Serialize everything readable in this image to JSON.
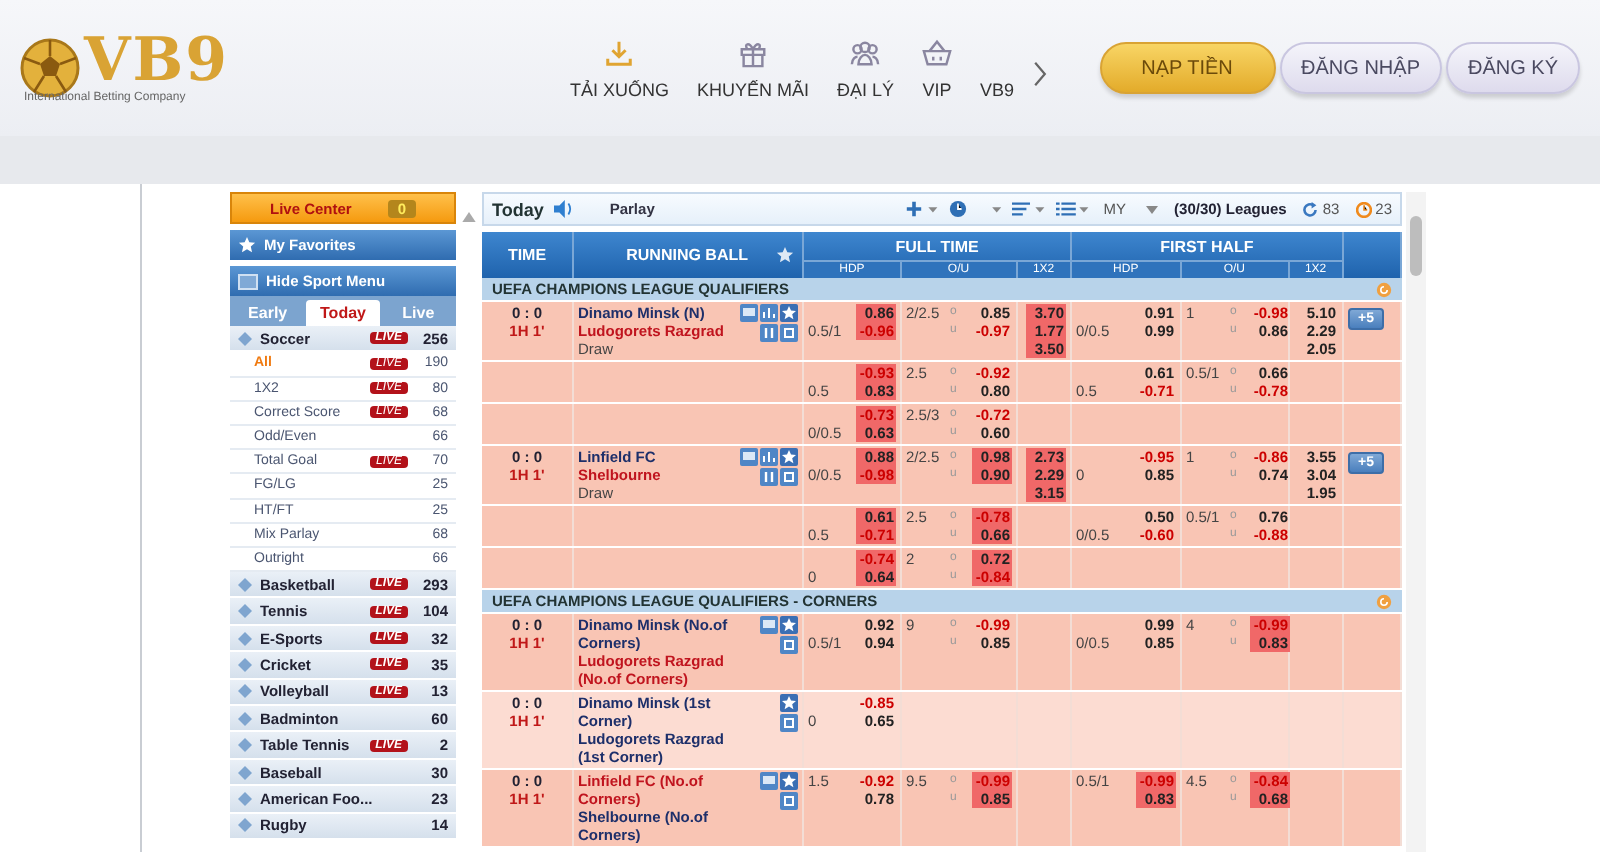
{
  "header": {
    "logo": {
      "name": "VB9",
      "tagline": "International Betting Company"
    },
    "nav": [
      {
        "label": "TẢI XUỐNG",
        "kind": "download"
      },
      {
        "label": "KHUYẾN MÃI",
        "kind": "gift"
      },
      {
        "label": "ĐẠI LÝ",
        "kind": "agents"
      },
      {
        "label": "VIP",
        "kind": "basket"
      },
      {
        "label": "VB9",
        "kind": "none"
      }
    ],
    "buttons": [
      {
        "label": "NẠP TIỀN",
        "kind": "primary"
      },
      {
        "label": "ĐĂNG NHẬP",
        "kind": "secondary"
      },
      {
        "label": "ĐĂNG KÝ",
        "kind": "secondary"
      }
    ]
  },
  "sidebar": {
    "live_center": {
      "label": "Live Center",
      "count": "0"
    },
    "favorites": "My Favorites",
    "menu_toggle": "Hide Sport Menu",
    "tabs": [
      {
        "label": "Early",
        "selected": false
      },
      {
        "label": "Today",
        "selected": true
      },
      {
        "label": "Live",
        "selected": false
      }
    ],
    "sports": [
      {
        "name": "Soccer",
        "badge": "LIVE",
        "count": "256",
        "expanded": true,
        "children": [
          {
            "name": "All",
            "badge": "LIVE",
            "count": "190",
            "selected": true
          },
          {
            "name": "1X2",
            "badge": "LIVE",
            "count": "80",
            "selected": false
          },
          {
            "name": "Correct Score",
            "badge": "LIVE",
            "count": "68",
            "selected": false
          },
          {
            "name": "Odd/Even",
            "count": "66",
            "selected": false
          },
          {
            "name": "Total Goal",
            "badge": "LIVE",
            "count": "70",
            "selected": false
          },
          {
            "name": "FG/LG",
            "count": "25",
            "selected": false
          },
          {
            "name": "HT/FT",
            "count": "25",
            "selected": false
          },
          {
            "name": "Mix Parlay",
            "count": "68",
            "selected": false
          },
          {
            "name": "Outright",
            "count": "66",
            "selected": false
          }
        ]
      },
      {
        "name": "Basketball",
        "badge": "LIVE",
        "count": "293",
        "expanded": false
      },
      {
        "name": "Tennis",
        "badge": "LIVE",
        "count": "104",
        "expanded": false
      },
      {
        "name": "E-Sports",
        "badge": "LIVE",
        "count": "32",
        "expanded": false
      },
      {
        "name": "Cricket",
        "badge": "LIVE",
        "count": "35",
        "expanded": false
      },
      {
        "name": "Volleyball",
        "badge": "LIVE",
        "count": "13",
        "expanded": false
      },
      {
        "name": "Badminton",
        "count": "60",
        "expanded": false
      },
      {
        "name": "Table Tennis",
        "badge": "LIVE",
        "count": "2",
        "expanded": false
      },
      {
        "name": "Baseball",
        "count": "30",
        "expanded": false
      },
      {
        "name": "American Foo...",
        "count": "23",
        "expanded": false
      },
      {
        "name": "Rugby",
        "count": "14",
        "expanded": false
      }
    ]
  },
  "toolbar": {
    "title": "Today",
    "mode": "Parlay",
    "odds_type": "MY",
    "leagues": "(30/30) Leagues",
    "counters": [
      {
        "kind": "refresh",
        "value": "83"
      },
      {
        "kind": "timer",
        "value": "23"
      }
    ]
  },
  "columns": {
    "time": "TIME",
    "running": "RUNNING BALL",
    "groups": [
      {
        "label": "FULL TIME",
        "subs": [
          "HDP",
          "O/U",
          "1X2"
        ]
      },
      {
        "label": "FIRST HALF",
        "subs": [
          "HDP",
          "O/U",
          "1X2"
        ]
      }
    ]
  },
  "leagues": [
    {
      "name": "UEFA CHAMPIONS LEAGUE QUALIFIERS",
      "matches": [
        {
          "score": "0 : 0",
          "clock": "1H 1'",
          "teams": [
            {
              "name": "Dinamo Minsk (N)",
              "favorite": false
            },
            {
              "name": "Ludogorets Razgrad",
              "favorite": true
            }
          ],
          "draw": "Draw",
          "tv": true,
          "stats": true,
          "pause": true,
          "more": "+5",
          "light": false,
          "lines": [
            {
              "ft": {
                "hdp": [
                  {
                    "odds": "0.86",
                    "negative": false,
                    "hot": true
                  },
                  {
                    "line": "0.5/1",
                    "odds": "-0.96",
                    "negative": true,
                    "hot": true
                  }
                ],
                "ou": [
                  {
                    "line": "2/2.5",
                    "mark": "o",
                    "odds": "0.85",
                    "negative": false,
                    "hot": false
                  },
                  {
                    "mark": "u",
                    "odds": "-0.97",
                    "negative": true,
                    "hot": false
                  }
                ],
                "x12": [
                  {
                    "odds": "3.70",
                    "negative": false,
                    "hot": true
                  },
                  {
                    "odds": "1.77",
                    "negative": false,
                    "hot": true
                  },
                  {
                    "odds": "3.50",
                    "negative": false,
                    "hot": true
                  }
                ]
              },
              "fh": {
                "hdp": [
                  {
                    "odds": "0.91",
                    "negative": false,
                    "hot": false
                  },
                  {
                    "line": "0/0.5",
                    "odds": "0.99",
                    "negative": false,
                    "hot": false
                  }
                ],
                "ou": [
                  {
                    "line": "1",
                    "mark": "o",
                    "odds": "-0.98",
                    "negative": true,
                    "hot": false
                  },
                  {
                    "mark": "u",
                    "odds": "0.86",
                    "negative": false,
                    "hot": false
                  }
                ],
                "x12": [
                  {
                    "odds": "5.10",
                    "negative": false,
                    "hot": false
                  },
                  {
                    "odds": "2.29",
                    "negative": false,
                    "hot": false
                  },
                  {
                    "odds": "2.05",
                    "negative": false,
                    "hot": false
                  }
                ]
              }
            },
            {
              "ft": {
                "hdp": [
                  {
                    "odds": "-0.93",
                    "negative": true,
                    "hot": true
                  },
                  {
                    "line": "0.5",
                    "odds": "0.83",
                    "negative": false,
                    "hot": true
                  }
                ],
                "ou": [
                  {
                    "line": "2.5",
                    "mark": "o",
                    "odds": "-0.92",
                    "negative": true,
                    "hot": false
                  },
                  {
                    "mark": "u",
                    "odds": "0.80",
                    "negative": false,
                    "hot": false
                  }
                ]
              },
              "fh": {
                "hdp": [
                  {
                    "odds": "0.61",
                    "negative": false,
                    "hot": false
                  },
                  {
                    "line": "0.5",
                    "odds": "-0.71",
                    "negative": true,
                    "hot": false
                  }
                ],
                "ou": [
                  {
                    "line": "0.5/1",
                    "mark": "o",
                    "odds": "0.66",
                    "negative": false,
                    "hot": false
                  },
                  {
                    "mark": "u",
                    "odds": "-0.78",
                    "negative": true,
                    "hot": false
                  }
                ]
              }
            },
            {
              "ft": {
                "hdp": [
                  {
                    "odds": "-0.73",
                    "negative": true,
                    "hot": true
                  },
                  {
                    "line": "0/0.5",
                    "odds": "0.63",
                    "negative": false,
                    "hot": true
                  }
                ],
                "ou": [
                  {
                    "line": "2.5/3",
                    "mark": "o",
                    "odds": "-0.72",
                    "negative": true,
                    "hot": false
                  },
                  {
                    "mark": "u",
                    "odds": "0.60",
                    "negative": false,
                    "hot": false
                  }
                ]
              }
            }
          ]
        },
        {
          "score": "0 : 0",
          "clock": "1H 1'",
          "teams": [
            {
              "name": "Linfield FC",
              "favorite": false
            },
            {
              "name": "Shelbourne",
              "favorite": true
            }
          ],
          "draw": "Draw",
          "tv": true,
          "stats": true,
          "pause": true,
          "more": "+5",
          "light": false,
          "lines": [
            {
              "ft": {
                "hdp": [
                  {
                    "odds": "0.88",
                    "negative": false,
                    "hot": true
                  },
                  {
                    "line": "0/0.5",
                    "odds": "-0.98",
                    "negative": true,
                    "hot": true
                  }
                ],
                "ou": [
                  {
                    "line": "2/2.5",
                    "mark": "o",
                    "odds": "0.98",
                    "negative": false,
                    "hot": true
                  },
                  {
                    "mark": "u",
                    "odds": "0.90",
                    "negative": false,
                    "hot": true
                  }
                ],
                "x12": [
                  {
                    "odds": "2.73",
                    "negative": false,
                    "hot": true
                  },
                  {
                    "odds": "2.29",
                    "negative": false,
                    "hot": true
                  },
                  {
                    "odds": "3.15",
                    "negative": false,
                    "hot": true
                  }
                ]
              },
              "fh": {
                "hdp": [
                  {
                    "odds": "-0.95",
                    "negative": true,
                    "hot": false
                  },
                  {
                    "line": "0",
                    "odds": "0.85",
                    "negative": false,
                    "hot": false
                  }
                ],
                "ou": [
                  {
                    "line": "1",
                    "mark": "o",
                    "odds": "-0.86",
                    "negative": true,
                    "hot": false
                  },
                  {
                    "mark": "u",
                    "odds": "0.74",
                    "negative": false,
                    "hot": false
                  }
                ],
                "x12": [
                  {
                    "odds": "3.55",
                    "negative": false,
                    "hot": false
                  },
                  {
                    "odds": "3.04",
                    "negative": false,
                    "hot": false
                  },
                  {
                    "odds": "1.95",
                    "negative": false,
                    "hot": false
                  }
                ]
              }
            },
            {
              "ft": {
                "hdp": [
                  {
                    "odds": "0.61",
                    "negative": false,
                    "hot": true
                  },
                  {
                    "line": "0.5",
                    "odds": "-0.71",
                    "negative": true,
                    "hot": true
                  }
                ],
                "ou": [
                  {
                    "line": "2.5",
                    "mark": "o",
                    "odds": "-0.78",
                    "negative": true,
                    "hot": true
                  },
                  {
                    "mark": "u",
                    "odds": "0.66",
                    "negative": false,
                    "hot": true
                  }
                ]
              },
              "fh": {
                "hdp": [
                  {
                    "odds": "0.50",
                    "negative": false,
                    "hot": false
                  },
                  {
                    "line": "0/0.5",
                    "odds": "-0.60",
                    "negative": true,
                    "hot": false
                  }
                ],
                "ou": [
                  {
                    "line": "0.5/1",
                    "mark": "o",
                    "odds": "0.76",
                    "negative": false,
                    "hot": false
                  },
                  {
                    "mark": "u",
                    "odds": "-0.88",
                    "negative": true,
                    "hot": false
                  }
                ]
              }
            },
            {
              "ft": {
                "hdp": [
                  {
                    "odds": "-0.74",
                    "negative": true,
                    "hot": true
                  },
                  {
                    "line": "0",
                    "odds": "0.64",
                    "negative": false,
                    "hot": true
                  }
                ],
                "ou": [
                  {
                    "line": "2",
                    "mark": "o",
                    "odds": "0.72",
                    "negative": false,
                    "hot": true
                  },
                  {
                    "mark": "u",
                    "odds": "-0.84",
                    "negative": true,
                    "hot": true
                  }
                ]
              }
            }
          ]
        }
      ]
    },
    {
      "name": "UEFA CHAMPIONS LEAGUE QUALIFIERS - CORNERS",
      "matches": [
        {
          "score": "0 : 0",
          "clock": "1H 1'",
          "teams": [
            {
              "name": "Dinamo Minsk (No.of Corners)",
              "favorite": false
            },
            {
              "name": "Ludogorets Razgrad (No.of Corners)",
              "favorite": true
            }
          ],
          "tv": true,
          "stats": false,
          "pause": false,
          "light": false,
          "lines": [
            {
              "ft": {
                "hdp": [
                  {
                    "odds": "0.92",
                    "negative": false,
                    "hot": false
                  },
                  {
                    "line": "0.5/1",
                    "odds": "0.94",
                    "negative": false,
                    "hot": false
                  }
                ],
                "ou": [
                  {
                    "line": "9",
                    "mark": "o",
                    "odds": "-0.99",
                    "negative": true,
                    "hot": false
                  },
                  {
                    "mark": "u",
                    "odds": "0.85",
                    "negative": false,
                    "hot": false
                  }
                ]
              },
              "fh": {
                "hdp": [
                  {
                    "odds": "0.99",
                    "negative": false,
                    "hot": false
                  },
                  {
                    "line": "0/0.5",
                    "odds": "0.85",
                    "negative": false,
                    "hot": false
                  }
                ],
                "ou": [
                  {
                    "line": "4",
                    "mark": "o",
                    "odds": "-0.99",
                    "negative": true,
                    "hot": true
                  },
                  {
                    "mark": "u",
                    "odds": "0.83",
                    "negative": false,
                    "hot": true
                  }
                ]
              }
            }
          ]
        },
        {
          "score": "0 : 0",
          "clock": "1H 1'",
          "teams": [
            {
              "name": "Dinamo Minsk (1st Corner)",
              "favorite": false
            },
            {
              "name": "Ludogorets Razgrad (1st Corner)",
              "favorite": false
            }
          ],
          "tv": false,
          "stats": false,
          "pause": false,
          "light": true,
          "lines": [
            {
              "ft": {
                "hdp": [
                  {
                    "odds": "-0.85",
                    "negative": true,
                    "hot": false
                  },
                  {
                    "line": "0",
                    "odds": "0.65",
                    "negative": false,
                    "hot": false
                  }
                ]
              }
            }
          ]
        },
        {
          "score": "0 : 0",
          "clock": "1H 1'",
          "teams": [
            {
              "name": "Linfield FC (No.of Corners)",
              "favorite": true
            },
            {
              "name": "Shelbourne (No.of Corners)",
              "favorite": false
            }
          ],
          "tv": true,
          "stats": false,
          "pause": false,
          "light": false,
          "lines": [
            {
              "ft": {
                "hdp": [
                  {
                    "line": "1.5",
                    "odds": "-0.92",
                    "negative": true,
                    "hot": false
                  },
                  {
                    "odds": "0.78",
                    "negative": false,
                    "hot": false
                  }
                ],
                "ou": [
                  {
                    "line": "9.5",
                    "mark": "o",
                    "odds": "-0.99",
                    "negative": true,
                    "hot": true
                  },
                  {
                    "mark": "u",
                    "odds": "0.85",
                    "negative": false,
                    "hot": true
                  }
                ]
              },
              "fh": {
                "hdp": [
                  {
                    "line": "0.5/1",
                    "odds": "-0.99",
                    "negative": true,
                    "hot": true
                  },
                  {
                    "odds": "0.83",
                    "negative": false,
                    "hot": true
                  }
                ],
                "ou": [
                  {
                    "line": "4.5",
                    "mark": "o",
                    "odds": "-0.84",
                    "negative": true,
                    "hot": true
                  },
                  {
                    "mark": "u",
                    "odds": "0.68",
                    "negative": false,
                    "hot": true
                  }
                ]
              }
            }
          ]
        }
      ]
    }
  ]
}
